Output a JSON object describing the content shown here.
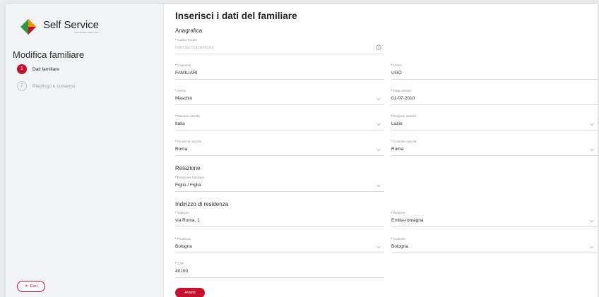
{
  "brand": {
    "title": "Self Service",
    "subtitle": "GESTIONE FAMILIARI",
    "colors": {
      "primary": "#c8102e",
      "logo_green": "#2e9a3f",
      "logo_orange": "#f29100",
      "logo_red": "#c8102e"
    }
  },
  "sidebar": {
    "title": "Modifica familiare",
    "steps": [
      {
        "num": "1",
        "label": "Dati familiare",
        "state": "active"
      },
      {
        "num": "2",
        "label": "Riepilogo e consensi",
        "state": "inactive"
      }
    ],
    "exit_icon": "close-icon",
    "exit_label": "Esci"
  },
  "main": {
    "title": "Inserisci i dati del familiare",
    "sections": {
      "anagrafica": "Anagrafica",
      "relazione": "Relazione",
      "residenza": "Indirizzo di residenza"
    },
    "fields": {
      "codice_fiscale": {
        "label": "Codice fiscale",
        "value": "",
        "placeholder": "FMLUGO10L01H501L",
        "icon": "help-circle-icon"
      },
      "cognome": {
        "label": "Cognome",
        "value": "FAMILIARI"
      },
      "nome": {
        "label": "Nome",
        "value": "UGO"
      },
      "sesso": {
        "label": "Sesso",
        "value": "Maschio"
      },
      "data_nascita": {
        "label": "Data nascita",
        "value": "01-07-2010"
      },
      "nazione_nascita": {
        "label": "Nazione nascita",
        "value": "Italia"
      },
      "regione_nascita": {
        "label": "Regione nascita",
        "value": "Lazio"
      },
      "provincia_nascita": {
        "label": "Provincia nascita",
        "value": "Roma"
      },
      "comune_nascita": {
        "label": "Comune nascita",
        "value": "Roma"
      },
      "relazione_familiare": {
        "label": "Relazione familiare",
        "value": "Figlio / Figlia"
      },
      "indirizzo": {
        "label": "Indirizzo",
        "value": "via Roma, 1"
      },
      "regione": {
        "label": "Regione",
        "value": "Emilia-romagna"
      },
      "provincia": {
        "label": "Provincia",
        "value": "Bologna"
      },
      "comune": {
        "label": "Comune",
        "value": "Bologna"
      },
      "cap": {
        "label": "CAP",
        "value": "40100"
      }
    },
    "required_marker": "*",
    "confirm_label": "Avanti"
  }
}
